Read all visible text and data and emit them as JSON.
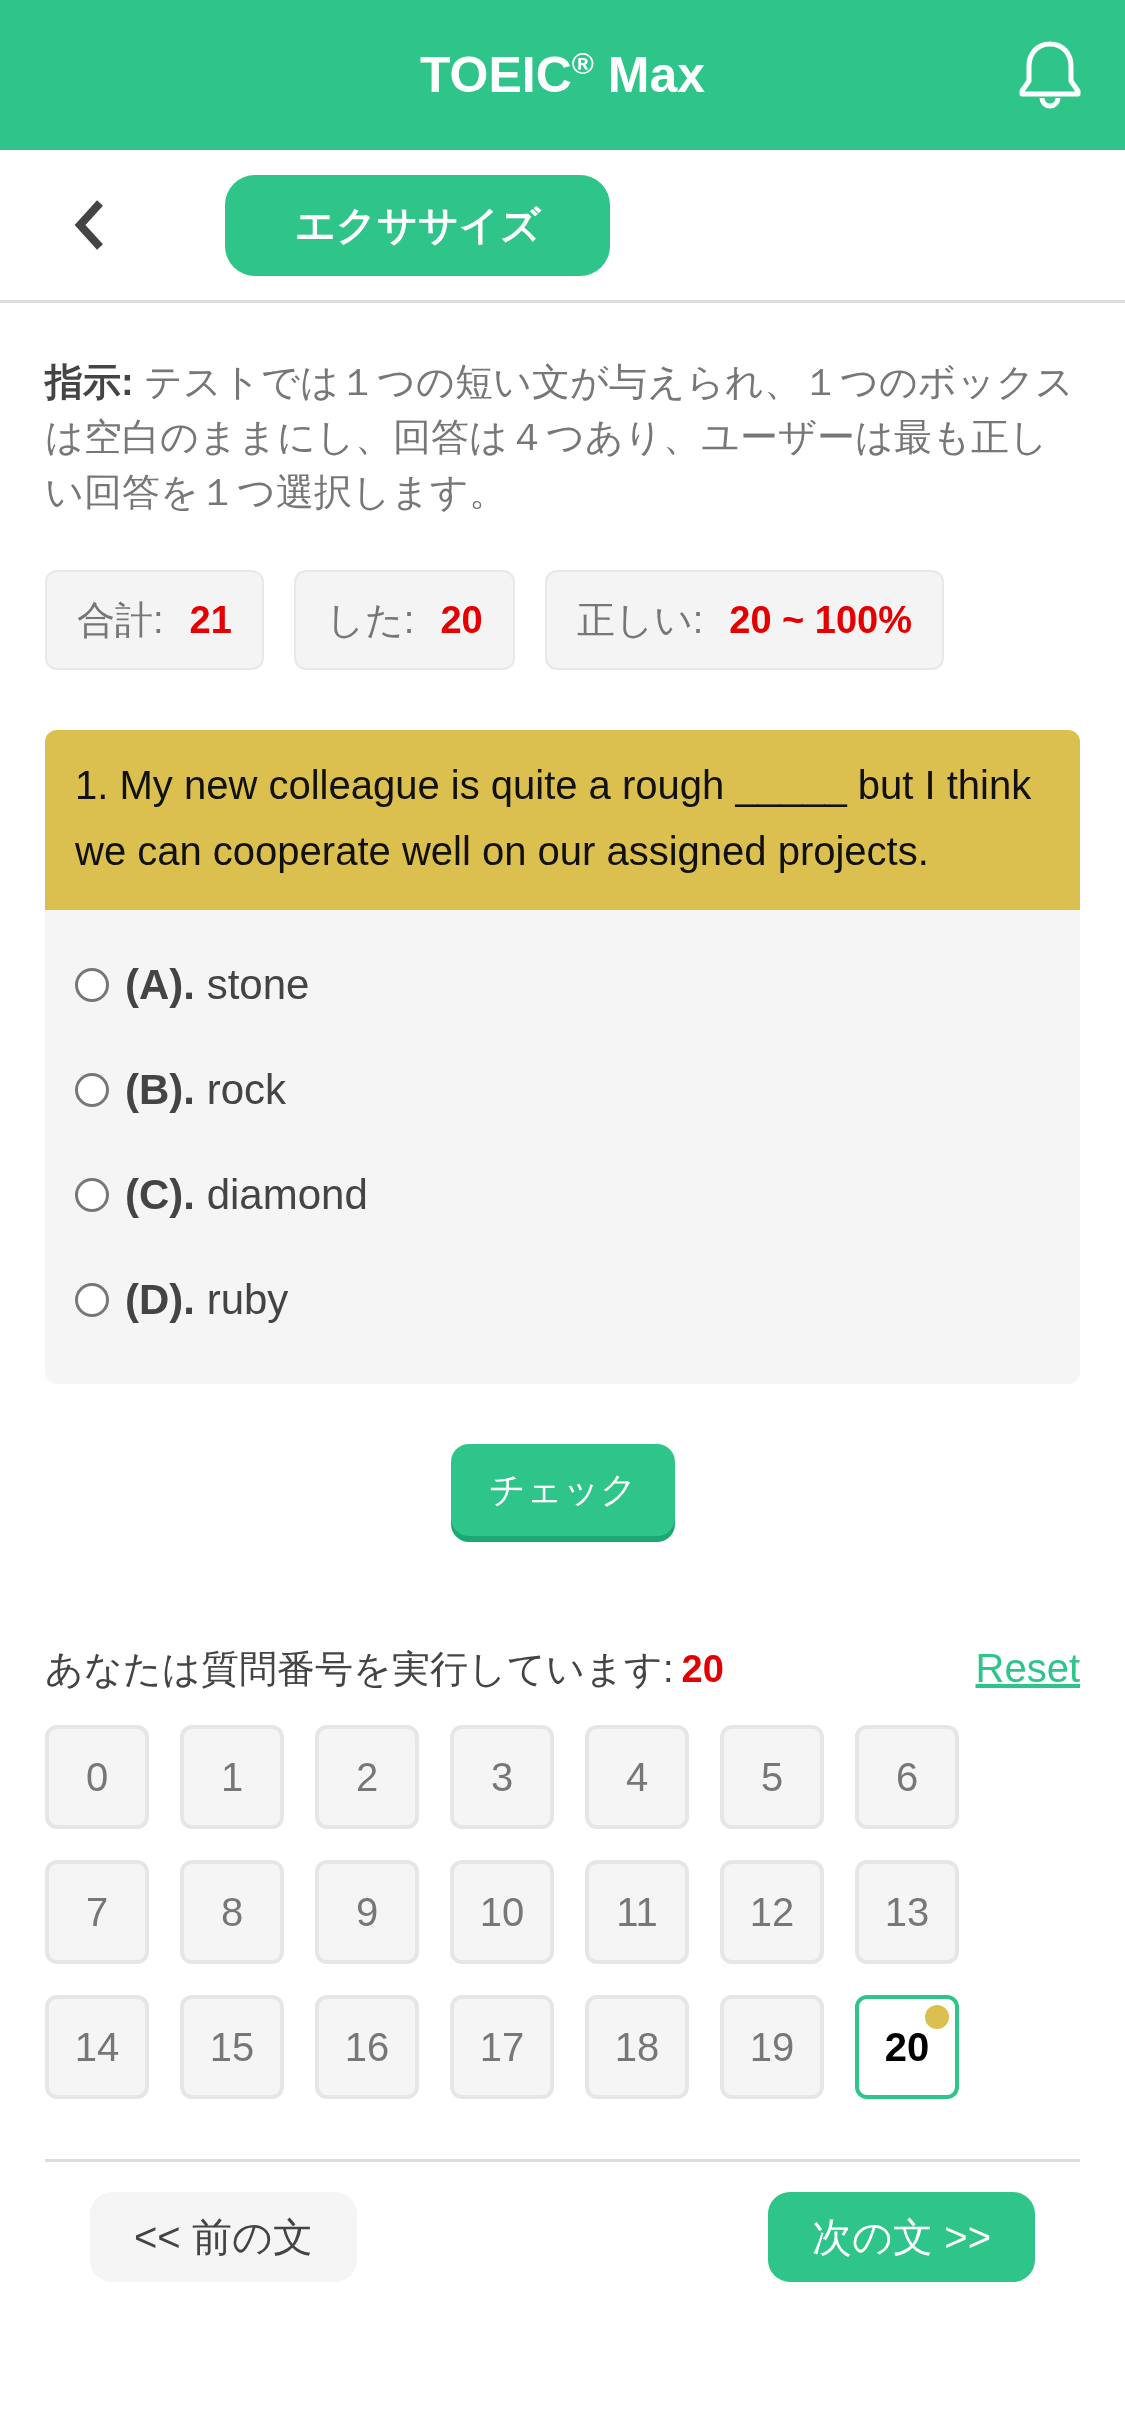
{
  "header": {
    "title": "TOEIC$^{®}$ Max"
  },
  "subbar": {
    "tab": "エクササイズ"
  },
  "instructions": "**指示:** テストでは１つの短い文が与えられ、１つのボックスは空白のままにし、回答は４つあり、ユーザーは最も正しい回答を１つ選択します。",
  "stats": [
    {
      "label": "合計:",
      "value": "21"
    },
    {
      "label": "した:",
      "value": "20"
    },
    {
      "label": "正しい:",
      "value": "20 ~ 100%"
    }
  ],
  "question": {
    "text": "1. My new colleague is quite a rough _____ but I think we can cooperate well on our assigned projects.",
    "options": [
      {
        "label": "**(A).** stone",
        "selected": false
      },
      {
        "label": "**(B).** rock",
        "selected": false
      },
      {
        "label": "**(C).** diamond",
        "selected": false
      },
      {
        "label": "**(D).** ruby",
        "selected": false
      }
    ]
  },
  "check_button": "チェック",
  "progress": {
    "label": "あなたは質問番号を実行しています:",
    "value": "20",
    "reset": "Reset"
  },
  "numbers": [
    {
      "label": "0",
      "selected": false,
      "marked": false
    },
    {
      "label": "1",
      "selected": false,
      "marked": false
    },
    {
      "label": "2",
      "selected": false,
      "marked": false
    },
    {
      "label": "3",
      "selected": false,
      "marked": false
    },
    {
      "label": "4",
      "selected": false,
      "marked": false
    },
    {
      "label": "5",
      "selected": false,
      "marked": false
    },
    {
      "label": "6",
      "selected": false,
      "marked": false
    },
    {
      "label": "7",
      "selected": false,
      "marked": false
    },
    {
      "label": "8",
      "selected": false,
      "marked": false
    },
    {
      "label": "9",
      "selected": false,
      "marked": false
    },
    {
      "label": "10",
      "selected": false,
      "marked": false
    },
    {
      "label": "11",
      "selected": false,
      "marked": false
    },
    {
      "label": "12",
      "selected": false,
      "marked": false
    },
    {
      "label": "13",
      "selected": false,
      "marked": false
    },
    {
      "label": "14",
      "selected": false,
      "marked": false
    },
    {
      "label": "15",
      "selected": false,
      "marked": false
    },
    {
      "label": "16",
      "selected": false,
      "marked": false
    },
    {
      "label": "17",
      "selected": false,
      "marked": false
    },
    {
      "label": "18",
      "selected": false,
      "marked": false
    },
    {
      "label": "19",
      "selected": false,
      "marked": false
    },
    {
      "label": "20",
      "selected": true,
      "marked": true
    }
  ],
  "nav": [
    {
      "label": "<< 前の文",
      "kind": "secondary"
    },
    {
      "label": "次の文 >>",
      "kind": "primary"
    }
  ]
}
